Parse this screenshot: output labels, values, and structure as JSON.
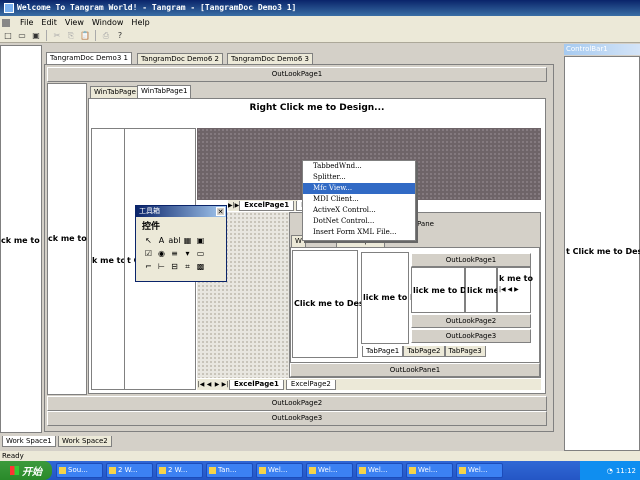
{
  "window": {
    "title": "Welcome To Tangram World! - Tangram - [TangramDoc Demo3 1]"
  },
  "menu": [
    {
      "label": "File"
    },
    {
      "label": "Edit"
    },
    {
      "label": "View"
    },
    {
      "label": "Window"
    },
    {
      "label": "Help"
    }
  ],
  "toolbar": {
    "icons": [
      "new-file-icon",
      "open-folder-icon",
      "save-icon",
      "cut-icon",
      "copy-icon",
      "paste-icon",
      "print-icon",
      "help-icon"
    ],
    "glyphs": [
      "□",
      "▭",
      "▣",
      "✂",
      "⎘",
      "📋",
      "⎙",
      "?"
    ]
  },
  "doc_tabs": [
    "TangramDoc Demo3 1",
    "TangramDoc Demo6 2",
    "TangramDoc Demo6 3"
  ],
  "right_panel": {
    "title": "ControlBar1",
    "text": "t Click me to Design..."
  },
  "left_outer_text": "ck me to",
  "outlook": {
    "page1": "OutLookPage1",
    "page2": "OutLookPage2",
    "page3": "OutLookPage3",
    "pane1": "OutLookPane1"
  },
  "left_inner_text": "ck me to",
  "wintabs": [
    "WinTabPage",
    "WinTabPage1"
  ],
  "design_header": "Right Click me to Design...",
  "col_text": "k me to",
  "col_text2": "t C",
  "context_menu": {
    "items": [
      "TabbedWnd...",
      "Splitter...",
      "Mfc View...",
      "MDI Client...",
      "ActiveX Control...",
      "DotNet Control...",
      "Insert Form XML File..."
    ],
    "highlighted_index": 2
  },
  "excel": {
    "tabs_top": [
      "ExcelPage1",
      "E"
    ],
    "tabs_bottom": [
      "ExcelPage1",
      "ExcelPage2"
    ]
  },
  "inner": {
    "pane_header": "Pane",
    "wintab_stub": "W",
    "wintab_stub2": "Work Space",
    "click_design": "Click me to Desi",
    "click_d": "lick me to D",
    "click_d2": "lick me to D",
    "click_d3": "lick me to D",
    "ko": "k me to",
    "outlook_pages": [
      "OutLookPage1",
      "OutLookPage2",
      "OutLookPage3"
    ],
    "tabs": [
      "TabPage1",
      "TabPage2",
      "TabPage3"
    ]
  },
  "toolbox": {
    "title": "工具箱",
    "section": "控件",
    "tools": [
      "pointer-icon",
      "text-icon",
      "label-icon",
      "grid-icon",
      "image-icon",
      "checkbox-icon",
      "radio-icon",
      "list-icon",
      "dropdown-icon",
      "frame-icon",
      "hscroll-icon",
      "vscroll-icon",
      "combo-icon",
      "calendar-icon",
      "picture-icon"
    ],
    "glyphs": [
      "↖",
      "A",
      "abl",
      "▦",
      "▣",
      "☑",
      "◉",
      "≡",
      "▾",
      "▭",
      "⌐",
      "⊢",
      "⊟",
      "⌗",
      "▩"
    ]
  },
  "workspace_tabs": [
    "Work Space1",
    "Work Space2"
  ],
  "status": "Ready",
  "taskbar": {
    "start": "开始",
    "items": [
      "Sou...",
      "2 W...",
      "2 W...",
      "Tan...",
      "Wel...",
      "Wel...",
      "Wel...",
      "Wel...",
      "Wel..."
    ],
    "clock": "11:12"
  },
  "colors": {
    "title_bar": "#0a246a",
    "menu_highlight": "#316ac5",
    "taskbar": "#2456c5",
    "design_area": "#6e6468"
  }
}
